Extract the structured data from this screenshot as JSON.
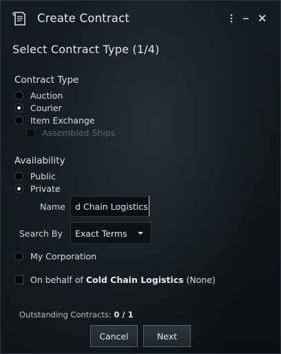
{
  "window": {
    "title": "Create Contract",
    "icons": {
      "app": "contract-icon",
      "menu": "kebab-menu-icon",
      "minimize": "minimize-icon",
      "close": "close-icon"
    }
  },
  "heading": "Select Contract Type (1/4)",
  "contract_type": {
    "label": "Contract Type",
    "options": [
      {
        "label": "Auction",
        "checked": false
      },
      {
        "label": "Courier",
        "checked": true
      },
      {
        "label": "Item Exchange",
        "checked": false
      }
    ],
    "assembled_ships": {
      "label": "Assembled Ships",
      "checked": false,
      "enabled": false
    }
  },
  "availability": {
    "label": "Availability",
    "options": [
      {
        "label": "Public",
        "checked": false
      },
      {
        "label": "Private",
        "checked": true
      }
    ],
    "name_label": "Name",
    "name_value": "d Chain Logistics",
    "search_by_label": "Search By",
    "search_by_value": "Exact Terms",
    "my_corporation": {
      "label": "My Corporation",
      "checked": false
    }
  },
  "on_behalf": {
    "prefix": "On behalf of",
    "corporation": "Cold Chain Logistics",
    "suffix": "(None)",
    "checked": false
  },
  "outstanding": {
    "label": "Outstanding Contracts:",
    "value": "0 / 1"
  },
  "buttons": {
    "cancel": "Cancel",
    "next": "Next"
  },
  "colors": {
    "background": "#0f1519",
    "text": "#d8dce0",
    "button_border": "#56626b"
  }
}
